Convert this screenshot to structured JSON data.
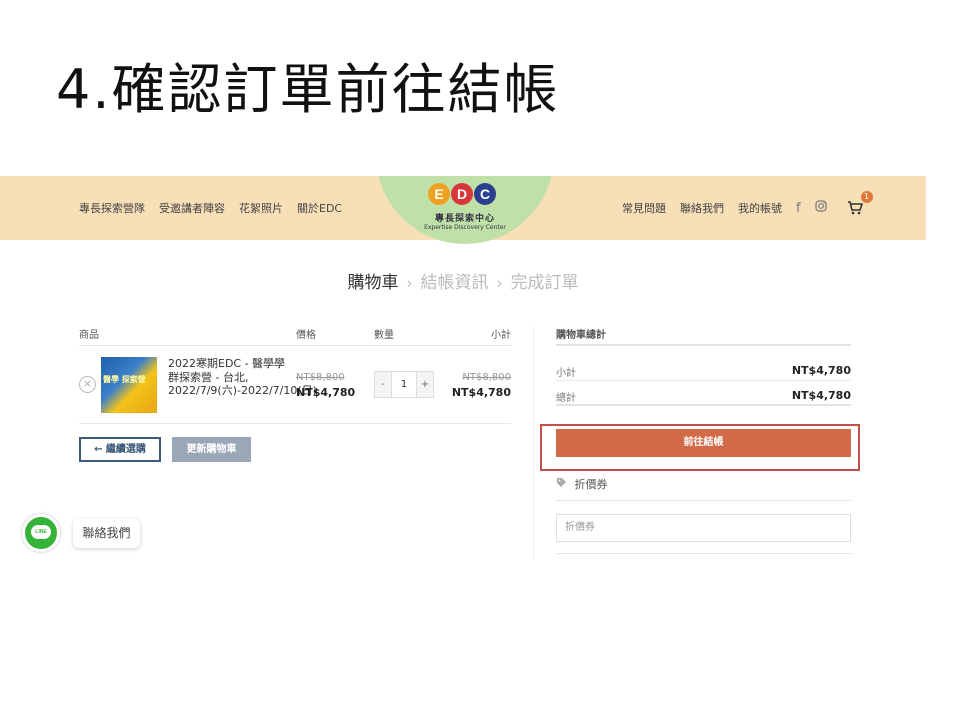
{
  "slide": {
    "title": "4.確認訂單前往結帳"
  },
  "header": {
    "nav_left": [
      "專長探索營隊",
      "受邀講者陣容",
      "花絮照片",
      "關於EDC"
    ],
    "nav_right": [
      "常見問題",
      "聯絡我們",
      "我的帳號"
    ],
    "social": [
      "facebook-icon",
      "instagram-icon"
    ],
    "cart_count": "1",
    "logo": {
      "letters": [
        "E",
        "D",
        "C"
      ],
      "letter_colors": [
        "#f0a020",
        "#d9383a",
        "#2a3f8f"
      ],
      "name": "專長探索中心",
      "english": "Expertise Discovery Center"
    }
  },
  "steps": {
    "step1": "購物車",
    "step2": "結帳資訊",
    "step3": "完成訂單",
    "separator": "›"
  },
  "cart": {
    "columns": {
      "product": "商品",
      "price": "價格",
      "quantity": "數量",
      "subtotal": "小計"
    },
    "items": [
      {
        "remove": "×",
        "thumb_text": "醫學 探索營",
        "name": "2022寒期EDC - 醫學學群探索營 - 台北, 2022/7/9(六)-2022/7/10(日)",
        "price_old": "NT$8,800",
        "price_new": "NT$4,780",
        "qty_minus": "-",
        "qty": "1",
        "qty_plus": "+",
        "subtotal_old": "NT$8,800",
        "subtotal_new": "NT$4,780"
      }
    ],
    "continue_label": "← 繼續選購",
    "update_label": "更新購物車"
  },
  "totals": {
    "title": "購物車總計",
    "subtotal_label": "小計",
    "subtotal_value": "NT$4,780",
    "total_label": "總計",
    "total_value": "NT$4,780",
    "checkout_label": "前往結帳",
    "accent": "#d06a48",
    "highlight": "#c0504d"
  },
  "coupon": {
    "title": "折價券",
    "placeholder": "折價券"
  },
  "floating": {
    "line_label": "LINE",
    "contact_label": "聯絡我們"
  }
}
